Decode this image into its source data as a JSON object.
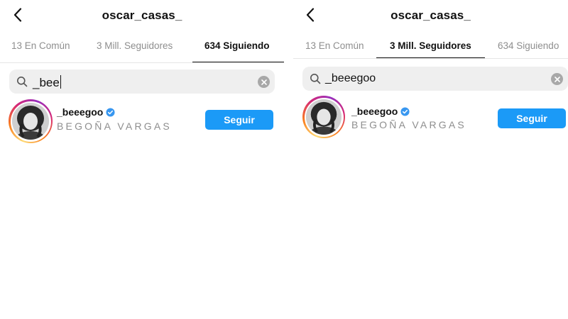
{
  "left": {
    "title": "oscar_casas_",
    "tabs": [
      "13 En Común",
      "3 Mill. Seguidores",
      "634 Siguiendo"
    ],
    "active_tab": 2,
    "search_value": "_bee",
    "result": {
      "username": "_beeegoo",
      "full_name": "BEGOÑA VARGAS",
      "verified": true,
      "button_label": "Seguir"
    }
  },
  "right": {
    "title": "oscar_casas_",
    "tabs": [
      "13 En Común",
      "3 Mill. Seguidores",
      "634 Siguiendo"
    ],
    "active_tab": 1,
    "search_value": "_beeegoo",
    "result": {
      "username": "_beeegoo",
      "full_name": "BEGOÑA VARGAS",
      "verified": true,
      "button_label": "Seguir"
    }
  },
  "icons": {
    "back": "chevron-left-icon",
    "search": "search-icon",
    "clear": "clear-icon",
    "verified": "verified-badge-icon"
  },
  "colors": {
    "follow_button": "#1b9af7",
    "verified_badge": "#3897f0",
    "tab_inactive": "#8e8e8e",
    "search_bg": "#efefef"
  }
}
